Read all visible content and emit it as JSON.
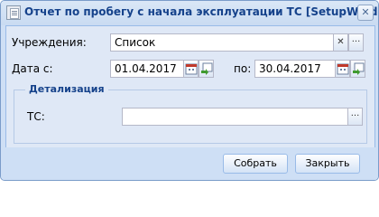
{
  "window": {
    "title": "Отчет по пробегу с начала эксплуатации ТС [SetupWindow]"
  },
  "form": {
    "institution_label": "Учреждения:",
    "institution_value": "Список",
    "date_from_label": "Дата с:",
    "date_from_value": "01.04.2017",
    "date_to_label": "по:",
    "date_to_value": "30.04.2017",
    "clear_glyph": "✕",
    "ellipsis_glyph": "···"
  },
  "detail": {
    "legend": "Детализация",
    "vehicle_label": "ТС:",
    "vehicle_value": ""
  },
  "footer": {
    "collect_label": "Собрать",
    "close_label": "Закрыть"
  },
  "icons": [
    "report-icon",
    "close-icon",
    "clear-icon",
    "ellipsis-icon",
    "calendar-icon",
    "calendar-arrow-icon"
  ],
  "colors": {
    "title": "#15428b",
    "frame": "#cedff5",
    "panel": "#dfe8f6"
  }
}
